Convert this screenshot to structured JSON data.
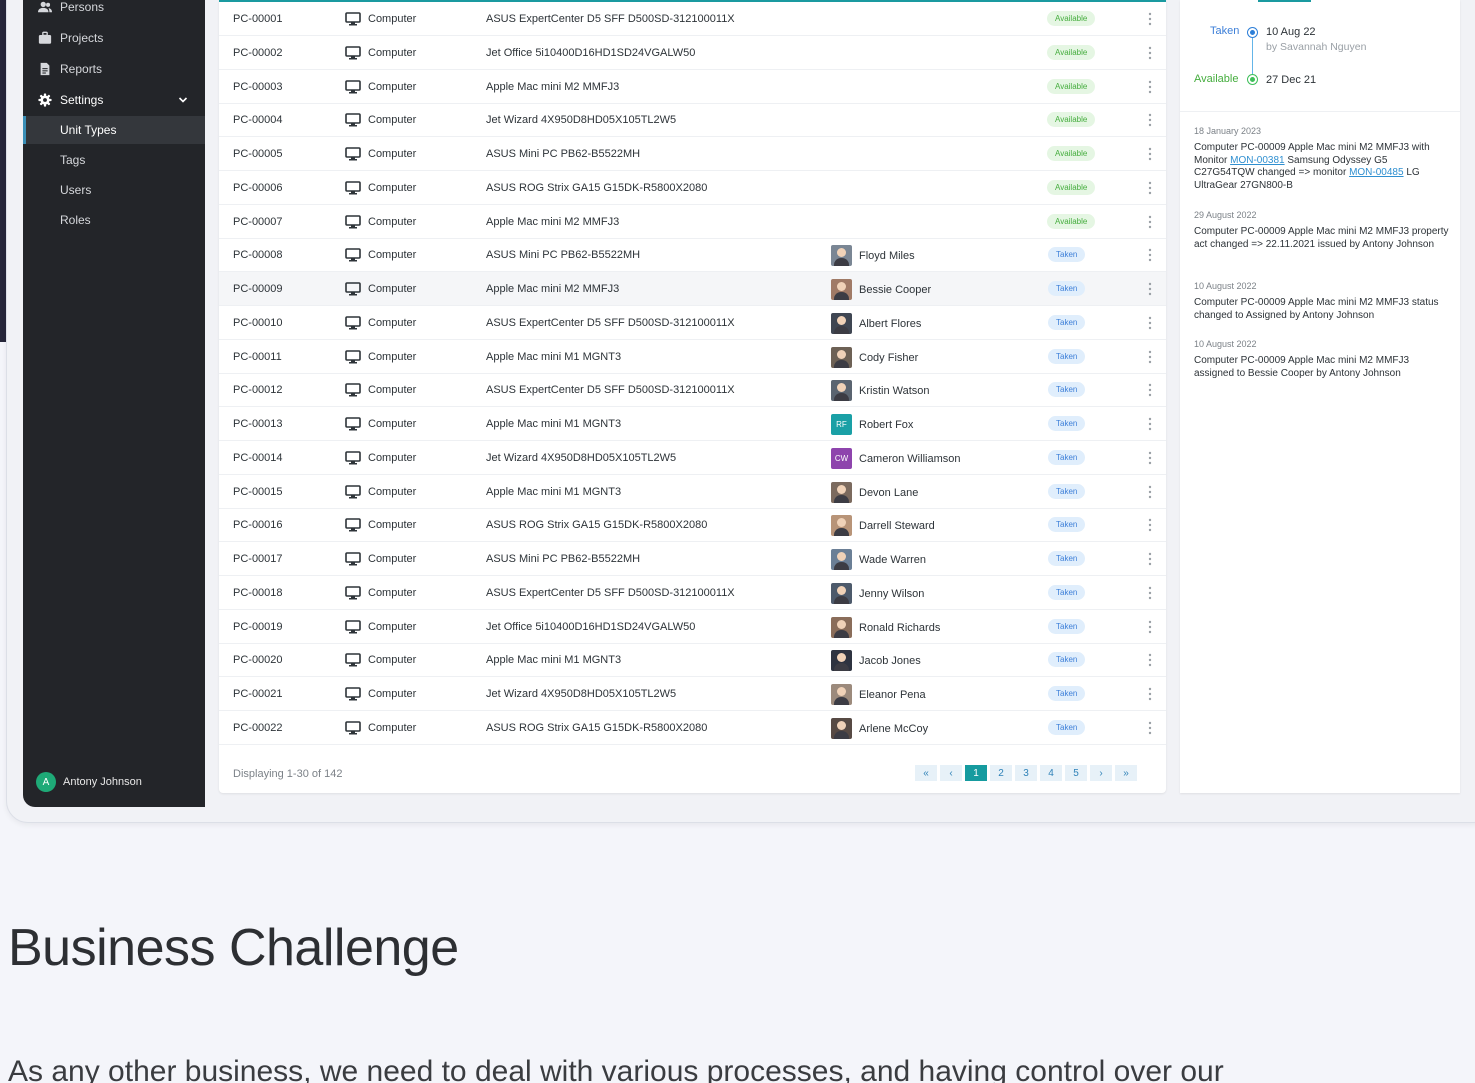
{
  "colors": {
    "accent": "#1a9aa0",
    "available": "#45ad3e",
    "taken": "#3d7fd8",
    "sidebar_bg": "#232529"
  },
  "sidebar": {
    "items": [
      {
        "label": "Persons",
        "icon": "persons-icon"
      },
      {
        "label": "Projects",
        "icon": "briefcase-icon"
      },
      {
        "label": "Reports",
        "icon": "document-icon"
      },
      {
        "label": "Settings",
        "icon": "gear-icon"
      },
      {
        "label": "Unit Types"
      },
      {
        "label": "Tags"
      },
      {
        "label": "Users"
      },
      {
        "label": "Roles"
      }
    ],
    "user": {
      "initial": "A",
      "name": "Antony Johnson"
    }
  },
  "table": {
    "rows": [
      {
        "id": "PC-00001",
        "type": "Computer",
        "model": "ASUS ExpertCenter D5 SFF D500SD-312100011X",
        "person": "",
        "status": "Available"
      },
      {
        "id": "PC-00002",
        "type": "Computer",
        "model": "Jet Office 5i10400D16HD1SD24VGALW50",
        "person": "",
        "status": "Available"
      },
      {
        "id": "PC-00003",
        "type": "Computer",
        "model": "Apple Mac mini M2 MMFJ3",
        "person": "",
        "status": "Available"
      },
      {
        "id": "PC-00004",
        "type": "Computer",
        "model": "Jet Wizard 4X950D8HD05X105TL2W5",
        "person": "",
        "status": "Available"
      },
      {
        "id": "PC-00005",
        "type": "Computer",
        "model": "ASUS Mini PC PB62-B5522MH",
        "person": "",
        "status": "Available"
      },
      {
        "id": "PC-00006",
        "type": "Computer",
        "model": "ASUS ROG Strix GA15 G15DK-R5800X2080",
        "person": "",
        "status": "Available"
      },
      {
        "id": "PC-00007",
        "type": "Computer",
        "model": "Apple Mac mini M2 MMFJ3",
        "person": "",
        "status": "Available"
      },
      {
        "id": "PC-00008",
        "type": "Computer",
        "model": "ASUS Mini PC PB62-B5522MH",
        "person": "Floyd Miles",
        "initials": "",
        "status": "Taken"
      },
      {
        "id": "PC-00009",
        "type": "Computer",
        "model": "Apple Mac mini M2 MMFJ3",
        "person": "Bessie Cooper",
        "initials": "",
        "status": "Taken"
      },
      {
        "id": "PC-00010",
        "type": "Computer",
        "model": "ASUS ExpertCenter D5 SFF D500SD-312100011X",
        "person": "Albert Flores",
        "initials": "",
        "status": "Taken"
      },
      {
        "id": "PC-00011",
        "type": "Computer",
        "model": "Apple Mac mini M1 MGNT3",
        "person": "Cody Fisher",
        "initials": "",
        "status": "Taken"
      },
      {
        "id": "PC-00012",
        "type": "Computer",
        "model": "ASUS ExpertCenter D5 SFF D500SD-312100011X",
        "person": "Kristin Watson",
        "initials": "",
        "status": "Taken"
      },
      {
        "id": "PC-00013",
        "type": "Computer",
        "model": "Apple Mac mini M1 MGNT3",
        "person": "Robert Fox",
        "initials": "RF",
        "status": "Taken"
      },
      {
        "id": "PC-00014",
        "type": "Computer",
        "model": "Jet Wizard 4X950D8HD05X105TL2W5",
        "person": "Cameron Williamson",
        "initials": "CW",
        "status": "Taken"
      },
      {
        "id": "PC-00015",
        "type": "Computer",
        "model": "Apple Mac mini M1 MGNT3",
        "person": "Devon Lane",
        "initials": "",
        "status": "Taken"
      },
      {
        "id": "PC-00016",
        "type": "Computer",
        "model": "ASUS ROG Strix GA15 G15DK-R5800X2080",
        "person": "Darrell Steward",
        "initials": "",
        "status": "Taken"
      },
      {
        "id": "PC-00017",
        "type": "Computer",
        "model": "ASUS Mini PC PB62-B5522MH",
        "person": "Wade Warren",
        "initials": "",
        "status": "Taken"
      },
      {
        "id": "PC-00018",
        "type": "Computer",
        "model": "ASUS ExpertCenter D5 SFF D500SD-312100011X",
        "person": "Jenny Wilson",
        "initials": "",
        "status": "Taken"
      },
      {
        "id": "PC-00019",
        "type": "Computer",
        "model": "Jet Office 5i10400D16HD1SD24VGALW50",
        "person": "Ronald Richards",
        "initials": "",
        "status": "Taken"
      },
      {
        "id": "PC-00020",
        "type": "Computer",
        "model": "Apple Mac mini M1 MGNT3",
        "person": "Jacob Jones",
        "initials": "",
        "status": "Taken"
      },
      {
        "id": "PC-00021",
        "type": "Computer",
        "model": "Jet Wizard 4X950D8HD05X105TL2W5",
        "person": "Eleanor Pena",
        "initials": "",
        "status": "Taken"
      },
      {
        "id": "PC-00022",
        "type": "Computer",
        "model": "ASUS ROG Strix GA15 G15DK-R5800X2080",
        "person": "Arlene McCoy",
        "initials": "",
        "status": "Taken"
      }
    ],
    "footer": "Displaying 1-30 of 142",
    "pagination": [
      "«",
      "‹",
      "1",
      "2",
      "3",
      "4",
      "5",
      "›",
      "»"
    ],
    "current_page": "1"
  },
  "detail": {
    "timeline": [
      {
        "status": "Taken",
        "date": "10 Aug 22",
        "by": "by Savannah Nguyen"
      },
      {
        "status": "Available",
        "date": "27 Dec 21"
      }
    ],
    "history": [
      {
        "date": "18 January 2023",
        "parts": [
          "Computer PC-00009 Apple Mac mini M2 MMFJ3 with Monitor ",
          "MON-00381",
          " Samsung Odyssey G5 C27G54TQW  changed => monitor ",
          "MON-00485",
          " LG UltraGear 27GN800-B"
        ]
      },
      {
        "date": "29 August 2022",
        "text": "Computer PC-00009 Apple Mac mini M2 MMFJ3 property act changed => 22.11.2021 issued by Antony Johnson"
      },
      {
        "date": "10 August 2022",
        "text": "Computer PC-00009 Apple Mac mini M2 MMFJ3 status changed to Assigned by Antony Johnson"
      },
      {
        "date": "10 August 2022",
        "text": "Computer PC-00009 Apple Mac mini M2 MMFJ3 assigned to Bessie Cooper by Antony Johnson"
      }
    ]
  },
  "article": {
    "heading": "Business Challenge",
    "paragraph": "As any other business, we need to deal with various processes, and having control over our"
  }
}
